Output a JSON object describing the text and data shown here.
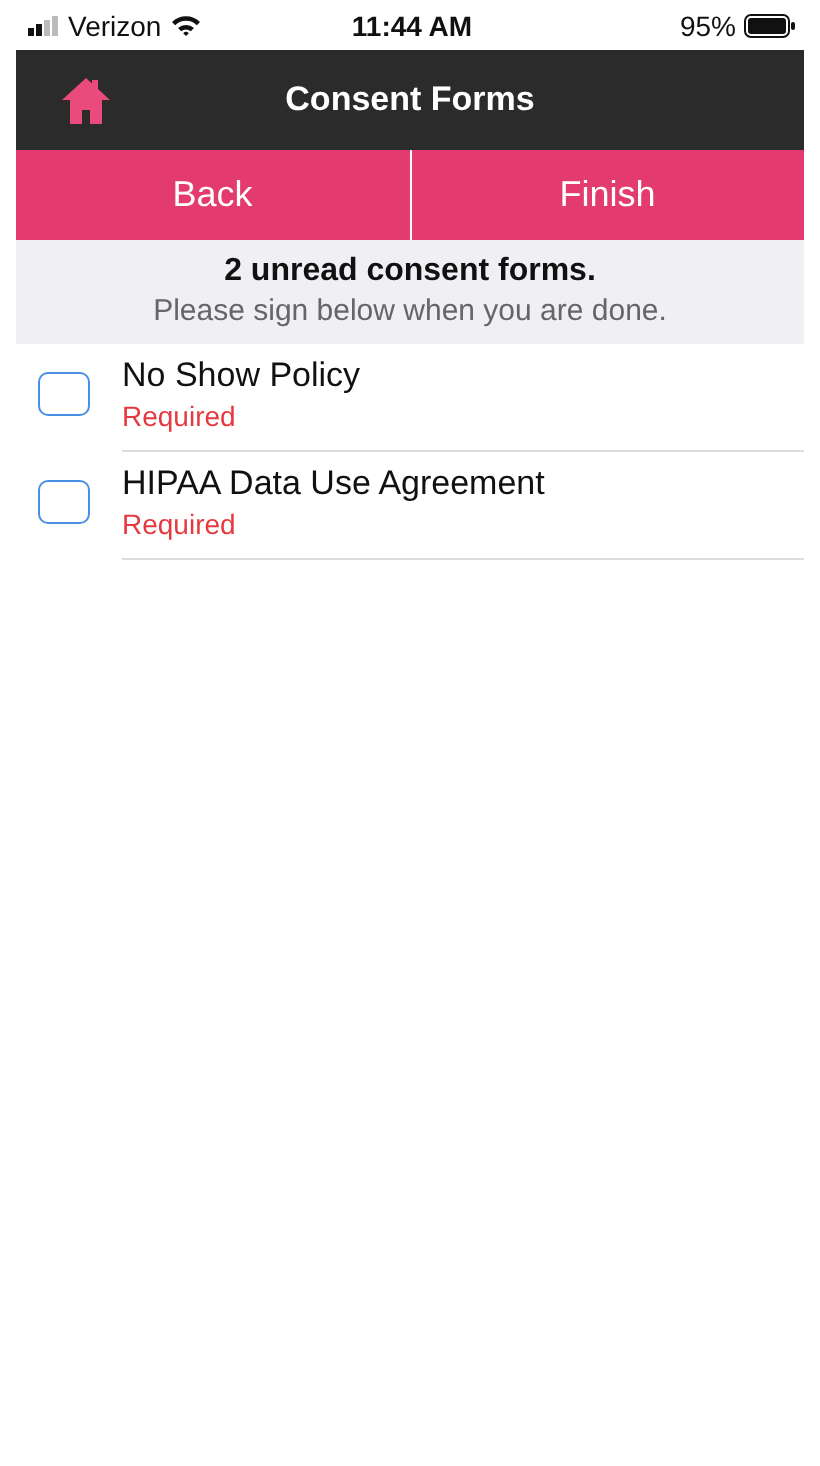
{
  "status_bar": {
    "carrier": "Verizon",
    "time": "11:44 AM",
    "battery": "95%"
  },
  "nav_bar": {
    "title": "Consent Forms"
  },
  "actions": [
    {
      "label": "Back"
    },
    {
      "label": "Finish"
    }
  ],
  "banner": {
    "title": "2 unread consent forms.",
    "subtitle": "Please sign below when you are done."
  },
  "forms": [
    {
      "name": "No Show Policy",
      "note": "Required",
      "checked": false
    },
    {
      "name": "HIPAA Data Use Agreement",
      "note": "Required",
      "checked": false
    }
  ]
}
